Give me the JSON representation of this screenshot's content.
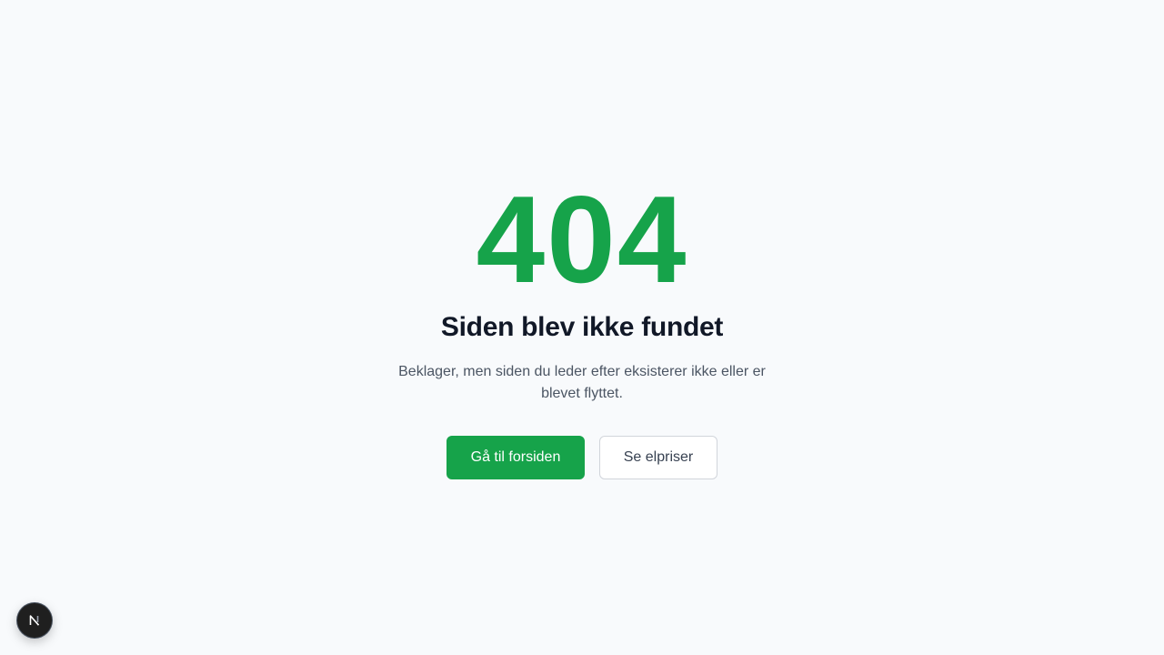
{
  "error": {
    "code": "404",
    "title": "Siden blev ikke fundet",
    "description": "Beklager, men siden du leder efter eksisterer ikke eller er blevet flyttet."
  },
  "actions": {
    "home_label": "Gå til forsiden",
    "prices_label": "Se elpriser"
  },
  "dev_badge": {
    "icon": "nextjs-logo-icon"
  },
  "colors": {
    "accent": "#16a34a",
    "heading": "#111827",
    "body_text": "#4b5563",
    "background": "#f8fafc"
  }
}
